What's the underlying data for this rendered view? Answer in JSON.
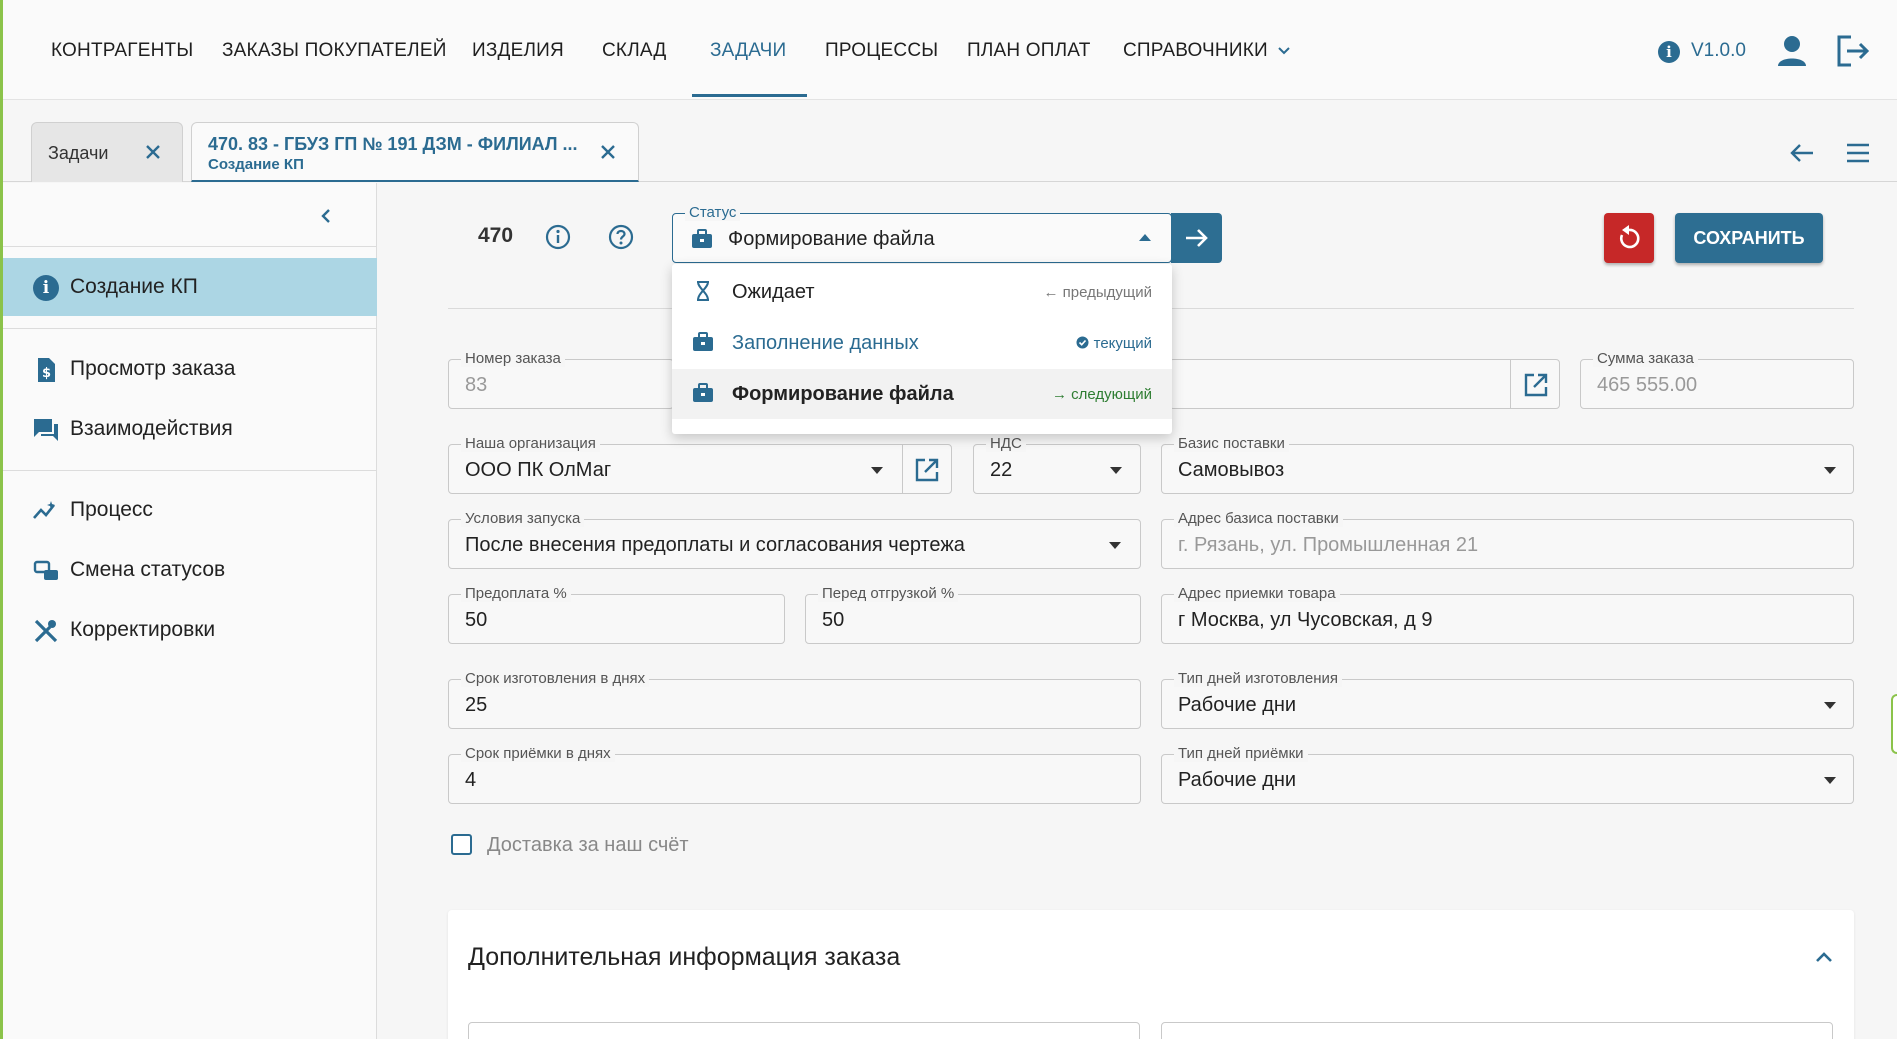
{
  "nav": {
    "items": [
      "КОНТРАГЕНТЫ",
      "ЗАКАЗЫ ПОКУПАТЕЛЕЙ",
      "ИЗДЕЛИЯ",
      "СКЛАД",
      "ЗАДАЧИ",
      "ПРОЦЕССЫ",
      "ПЛАН ОПЛАТ",
      "СПРАВОЧНИКИ"
    ],
    "active": "ЗАДАЧИ",
    "version": "V1.0.0"
  },
  "tabs": {
    "tab1": "Задачи",
    "tab2_title": "470. 83 - ГБУЗ ГП № 191 ДЗМ - ФИЛИАЛ ...",
    "tab2_sub": "Создание КП"
  },
  "sidebar": {
    "items": [
      "Создание КП",
      "Просмотр заказа",
      "Взаимодействия",
      "Процесс",
      "Смена статусов",
      "Корректировки"
    ],
    "active": "Создание КП"
  },
  "header": {
    "task_number": "470",
    "status_label": "Статус",
    "status_value": "Формирование файла",
    "save_label": "СОХРАНИТЬ"
  },
  "status_dropdown": {
    "options": [
      {
        "label": "Ожидает",
        "hint": "предыдущий"
      },
      {
        "label": "Заполнение данных",
        "hint": "текущий"
      },
      {
        "label": "Формирование файла",
        "hint": "следующий"
      }
    ]
  },
  "form": {
    "order_number": {
      "label": "Номер заказа",
      "value": "83"
    },
    "order_sum": {
      "label": "Сумма заказа",
      "value": "465 555.00"
    },
    "organization": {
      "label": "Наша организация",
      "value": "ООО ПК ОлМаг"
    },
    "vat": {
      "label": "НДС",
      "value": "22"
    },
    "delivery_basis": {
      "label": "Базис поставки",
      "value": "Самовывоз"
    },
    "launch_conditions": {
      "label": "Условия запуска",
      "value": "После внесения предоплаты и согласования чертежа"
    },
    "delivery_basis_address": {
      "label": "Адрес базиса поставки",
      "value": "г. Рязань, ул. Промышленная 21"
    },
    "prepayment": {
      "label": "Предоплата %",
      "value": "50"
    },
    "before_shipment": {
      "label": "Перед отгрузкой %",
      "value": "50"
    },
    "receiving_address": {
      "label": "Адрес приемки товара",
      "value": "г Москва, ул Чусовская, д 9"
    },
    "production_days": {
      "label": "Срок изготовления в днях",
      "value": "25"
    },
    "production_days_type": {
      "label": "Тип дней изготовления",
      "value": "Рабочие дни"
    },
    "acceptance_days": {
      "label": "Срок приёмки в днях",
      "value": "4"
    },
    "acceptance_days_type": {
      "label": "Тип дней приёмки",
      "value": "Рабочие дни"
    },
    "delivery_checkbox": "Доставка за наш счёт"
  },
  "additional": {
    "title": "Дополнительная информация заказа"
  },
  "colors": {
    "accent": "#2b6b91",
    "danger": "#c62828",
    "active_side": "#acd6e4",
    "next_hint": "#2e7d32"
  }
}
